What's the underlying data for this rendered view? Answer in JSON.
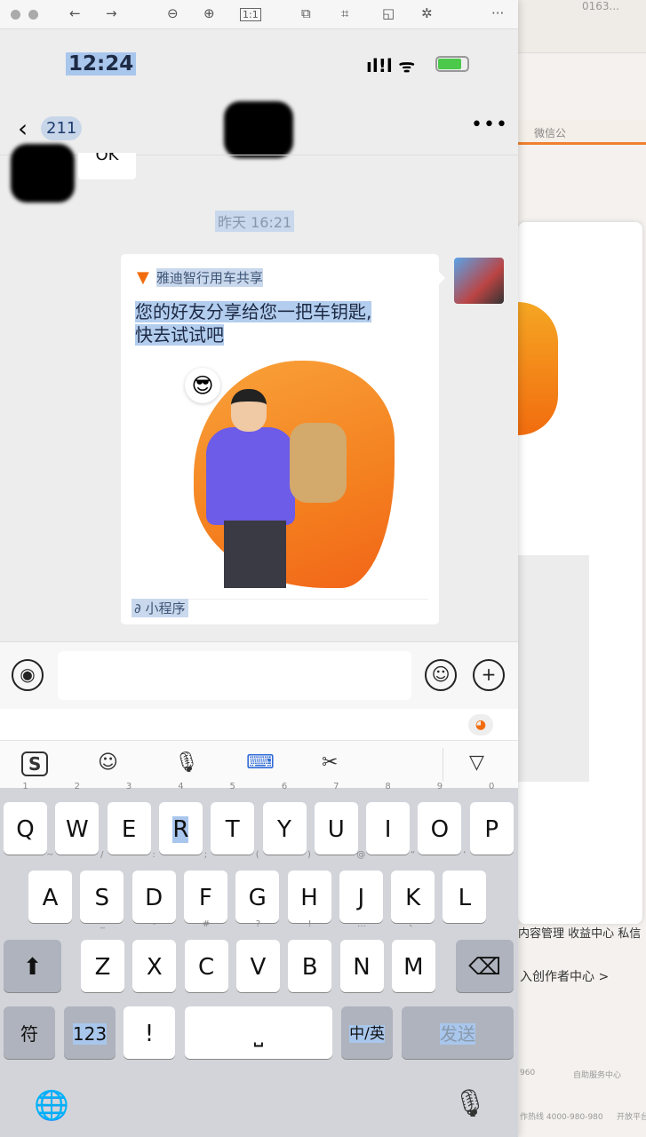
{
  "viewer_toolbar": {
    "icons": [
      "close-icon",
      "minimize-icon",
      "back-arrow-icon",
      "forward-arrow-icon",
      "zoom-out-icon",
      "zoom-in-icon",
      "actual-size-icon",
      "translate-icon",
      "crop-icon",
      "rotate-icon",
      "magic-wand-icon",
      "more-icon"
    ]
  },
  "status_bar": {
    "time": "12:24"
  },
  "chat_header": {
    "back_count": "211",
    "more": "•••"
  },
  "messages": {
    "prev_text": "OK",
    "timestamp": "昨天 16:21"
  },
  "card": {
    "source": "雅迪智行用车共享",
    "title_line1": "您的好友分享给您一把车钥匙,",
    "title_line2": "快去试试吧",
    "footer": "小程序"
  },
  "keyboard": {
    "row1": [
      [
        "1",
        "Q"
      ],
      [
        "2",
        "W"
      ],
      [
        "3",
        "E"
      ],
      [
        "4",
        "R"
      ],
      [
        "5",
        "T"
      ],
      [
        "6",
        "Y"
      ],
      [
        "7",
        "U"
      ],
      [
        "8",
        "I"
      ],
      [
        "9",
        "O"
      ],
      [
        "0",
        "P"
      ]
    ],
    "row2": [
      [
        "~",
        "A"
      ],
      [
        "/",
        "S"
      ],
      [
        ":",
        "D"
      ],
      [
        ";",
        "F"
      ],
      [
        "(",
        "G"
      ],
      [
        ")",
        "H"
      ],
      [
        "@",
        "J"
      ],
      [
        "“",
        "K"
      ],
      [
        "‘",
        "L"
      ]
    ],
    "row3": [
      [
        "_",
        "Z"
      ],
      [
        "-",
        "X"
      ],
      [
        "#",
        "C"
      ],
      [
        "?",
        "V"
      ],
      [
        "!",
        "B"
      ],
      [
        "…",
        "N"
      ],
      [
        "、",
        "M"
      ]
    ],
    "symbol": "符",
    "num": "123",
    "punct": "!",
    "lang": "中/英",
    "send": "发送",
    "space": "⎵"
  },
  "background_window": {
    "tab_text": "0163...",
    "wechat": "微信公",
    "nav": "内容管理   收益中心   私信",
    "creator": "入创作者中心  >",
    "phone1": "960",
    "self_service": "自助服务中心",
    "hotline": "作热线 4000-980-980",
    "open_platform": "开放平台"
  }
}
